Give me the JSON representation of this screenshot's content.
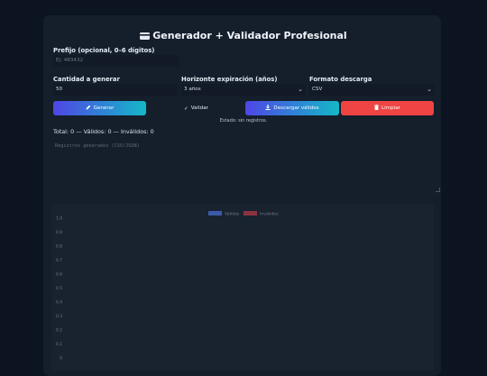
{
  "header": {
    "title": "Generador + Validador Profesional",
    "icon": "credit-card-icon"
  },
  "form": {
    "prefix_label": "Prefijo (opcional, 0–6 dígitos)",
    "prefix_placeholder": "Ej: 483432",
    "quantity_label": "Cantidad a generar",
    "quantity_value": "50",
    "horizon_label": "Horizonte expiración (años)",
    "horizon_value": "3 años",
    "format_label": "Formato descarga",
    "format_value": "CSV"
  },
  "buttons": {
    "generate": "Generar",
    "validate": "Validar",
    "download": "Descargar válidos",
    "clear": "Limpiar"
  },
  "status": {
    "message": "Estado: sin registros.",
    "totals": "Total: 0 — Válidos: 0 — Inválidos: 0"
  },
  "output": {
    "placeholder": "Registros generados (CSV/JSON)"
  },
  "colors": {
    "accent_start": "#4f46e5",
    "accent_end": "#14b8c8",
    "danger": "#ef4444",
    "valid_series": "#3b5aa8",
    "invalid_series": "#8a3340"
  },
  "chart_data": {
    "type": "bar",
    "categories": [],
    "series": [
      {
        "name": "Válidos",
        "values": []
      },
      {
        "name": "Inválidos",
        "values": []
      }
    ],
    "ylim": [
      0,
      1.0
    ],
    "yticks": [
      "1.0",
      "0.9",
      "0.8",
      "0.7",
      "0.6",
      "0.5",
      "0.4",
      "0.3",
      "0.2",
      "0.1",
      "0"
    ],
    "legend_position": "top-center",
    "grid": false
  }
}
